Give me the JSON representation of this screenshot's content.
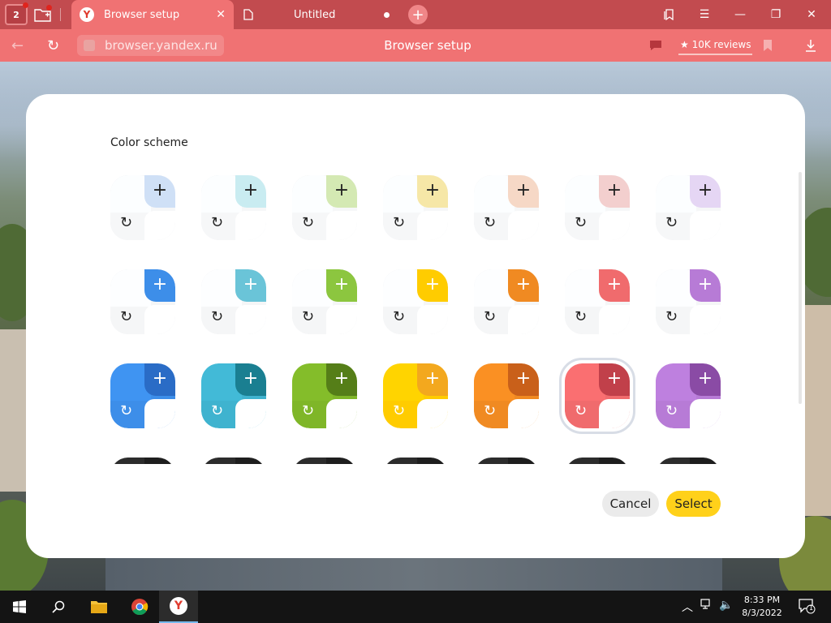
{
  "browser": {
    "tab_count": "2",
    "tabs": [
      {
        "title": "Browser setup",
        "active": true
      },
      {
        "title": "Untitled",
        "active": false
      }
    ],
    "url": "browser.yandex.ru",
    "page_title": "Browser setup",
    "reviews": "10K reviews"
  },
  "dialog": {
    "heading": "Color scheme",
    "cancel_label": "Cancel",
    "select_label": "Select",
    "palette": {
      "blue": {
        "light": [
          "#e3ecf8",
          "#cfe0f6"
        ],
        "mid": [
          "#e8eef7",
          "#3d8ee9"
        ],
        "strong": [
          "#3d8ee9",
          "#2a6cc6"
        ],
        "dark": "#2a2a2a"
      },
      "teal": {
        "light": [
          "#e1f1f6",
          "#c9ecf1"
        ],
        "mid": [
          "#e6f2f5",
          "#6ac4d8"
        ],
        "strong": [
          "#3fb3cf",
          "#1a7f91"
        ],
        "dark": "#2a2a2a"
      },
      "green": {
        "light": [
          "#eef4e3",
          "#d4e9b3"
        ],
        "mid": [
          "#edf3e3",
          "#8cc63f"
        ],
        "strong": [
          "#7fb628",
          "#557e18"
        ],
        "dark": "#2a2a2a"
      },
      "yellow": {
        "light": [
          "#fbf4dc",
          "#f6e7a7"
        ],
        "mid": [
          "#fbf4dc",
          "#ffcc00"
        ],
        "strong": [
          "#ffcc00",
          "#f3a81e"
        ],
        "dark": "#2a2a2a"
      },
      "orange": {
        "light": [
          "#fbede6",
          "#f6d8c6"
        ],
        "mid": [
          "#fcefe5",
          "#f08a22"
        ],
        "strong": [
          "#f08a22",
          "#c9601a"
        ],
        "dark": "#2a2a2a"
      },
      "red": {
        "light": [
          "#fbeceb",
          "#f3cfce"
        ],
        "mid": [
          "#fdeaea",
          "#f06b6d"
        ],
        "strong": [
          "#f06b6d",
          "#c1404a"
        ],
        "dark": "#2a2a2a"
      },
      "purple": {
        "light": [
          "#f3ecf8",
          "#e5d6f4"
        ],
        "mid": [
          "#f2ebf7",
          "#b77bd6"
        ],
        "strong": [
          "#b77bd6",
          "#8a4ba5"
        ],
        "dark": "#2a2a2a"
      }
    },
    "columns": [
      "blue",
      "teal",
      "green",
      "yellow",
      "orange",
      "red",
      "purple"
    ],
    "rows": [
      "light",
      "mid",
      "strong",
      "dark"
    ],
    "selected": {
      "row": "strong",
      "column": "red"
    }
  },
  "taskbar": {
    "time": "8:33 PM",
    "date": "8/3/2022",
    "notifications": "1"
  }
}
